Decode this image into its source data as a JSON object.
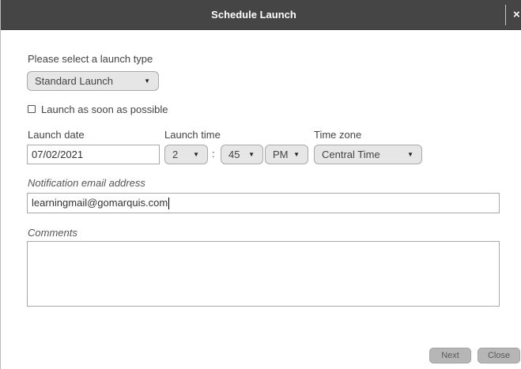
{
  "dialog": {
    "title": "Schedule Launch",
    "close_icon": "×"
  },
  "launch_type": {
    "label": "Please select a launch type",
    "selected": "Standard Launch"
  },
  "asap": {
    "label": "Launch as soon as possible",
    "checked": false
  },
  "launch_date": {
    "label": "Launch date",
    "value": "07/02/2021"
  },
  "launch_time": {
    "label": "Launch time",
    "hour": "2",
    "separator": ":",
    "minute": "45",
    "ampm": "PM"
  },
  "time_zone": {
    "label": "Time zone",
    "selected": "Central Time"
  },
  "notification": {
    "label": "Notification email address",
    "value": "learningmail@gomarquis.com"
  },
  "comments": {
    "label": "Comments",
    "value": ""
  },
  "buttons": {
    "next": "Next",
    "close": "Close"
  },
  "icons": {
    "dropdown": "▼"
  }
}
